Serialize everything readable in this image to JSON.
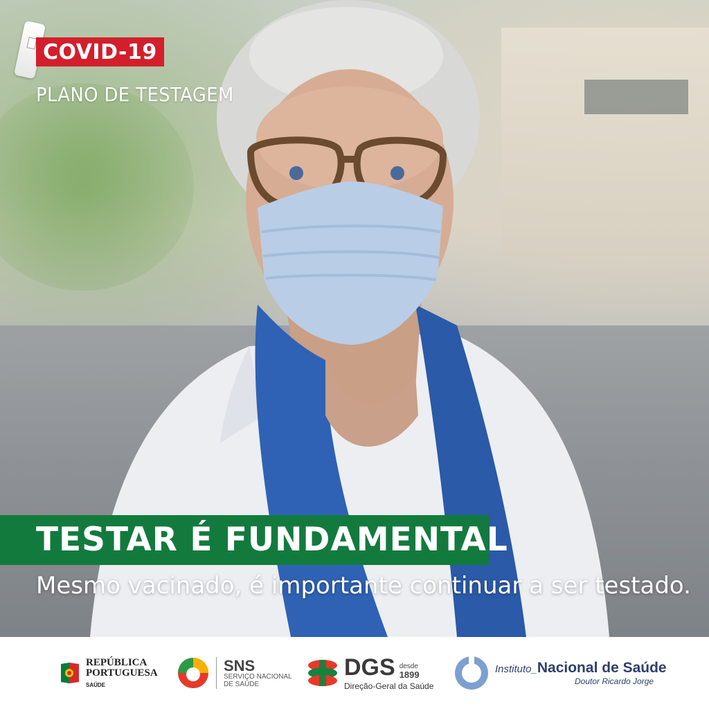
{
  "header": {
    "badge": "COVID-19",
    "subtitle": "PLANO DE TESTAGEM"
  },
  "headline": "TESTAR É FUNDAMENTAL",
  "subline": "Mesmo vacinado, é importante continuar a ser testado.",
  "footer": {
    "republica": {
      "line1": "REPÚBLICA",
      "line2": "PORTUGUESA",
      "sub": "SAÚDE"
    },
    "sns": {
      "title": "SNS",
      "line1": "SERVIÇO NACIONAL",
      "line2": "DE SAÚDE"
    },
    "dgs": {
      "title": "DGS",
      "desde": "desde",
      "year": "1899",
      "sub": "Direção-Geral da Saúde"
    },
    "insa": {
      "instituto": "Instituto_",
      "name": "Nacional de Saúde",
      "sub": "Doutor Ricardo Jorge"
    }
  },
  "colors": {
    "badge_red": "#d21f2b",
    "headline_green": "#137a3e",
    "insa_blue": "#2e3f6c"
  }
}
